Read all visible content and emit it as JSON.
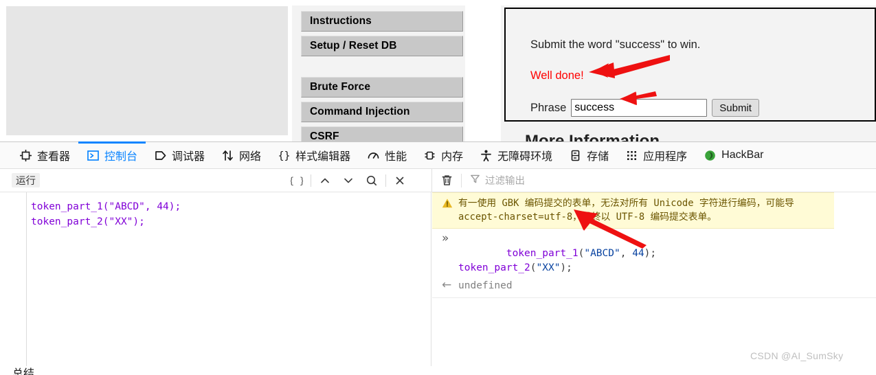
{
  "page": {
    "menu": {
      "items": [
        {
          "label": "Instructions",
          "name": "menu-instructions"
        },
        {
          "label": "Setup / Reset DB",
          "name": "menu-setup-reset-db"
        },
        {
          "label": "Brute Force",
          "name": "menu-brute-force"
        },
        {
          "label": "Command Injection",
          "name": "menu-command-injection"
        },
        {
          "label": "CSRF",
          "name": "menu-csrf"
        }
      ]
    },
    "xss": {
      "prompt": "Submit the word \"success\" to win.",
      "result": "Well done!",
      "phrase_label": "Phrase",
      "phrase_value": "success",
      "submit_label": "Submit",
      "more_info_heading": "More Information"
    }
  },
  "devtools": {
    "tabs": [
      {
        "label": "查看器",
        "icon": "inspector-icon",
        "active": false
      },
      {
        "label": "控制台",
        "icon": "console-icon",
        "active": true
      },
      {
        "label": "调试器",
        "icon": "debugger-icon",
        "active": false
      },
      {
        "label": "网络",
        "icon": "network-icon",
        "active": false
      },
      {
        "label": "样式编辑器",
        "icon": "style-editor-icon",
        "active": false
      },
      {
        "label": "性能",
        "icon": "performance-icon",
        "active": false
      },
      {
        "label": "内存",
        "icon": "memory-icon",
        "active": false
      },
      {
        "label": "无障碍环境",
        "icon": "accessibility-icon",
        "active": false
      },
      {
        "label": "存储",
        "icon": "storage-icon",
        "active": false
      },
      {
        "label": "应用程序",
        "icon": "application-icon",
        "active": false
      },
      {
        "label": "HackBar",
        "icon": "hackbar-icon",
        "active": false
      }
    ],
    "toolbar": {
      "run_label": "运行",
      "pretty_print_label": "{ }",
      "prev_label": "∧",
      "next_label": "∨",
      "find_label": "search-icon",
      "close_label": "✕",
      "trash_label": "trash-icon",
      "filter_placeholder": "过滤输出"
    },
    "editor": {
      "code_line_1": "token_part_1(\"ABCD\", 44);",
      "code_line_2": "token_part_2(\"XX\");"
    },
    "output": {
      "warning": {
        "line1": "有一使用 GBK 编码提交的表单，无法对所有 Unicode 字符进行编码，可能导",
        "line2": "accept-charset=utf-8，最终以 UTF-8 编码提交表单。"
      },
      "command": {
        "marker": "»",
        "line1_fn": "token_part_1",
        "line1_arg1": "\"ABCD\"",
        "line1_arg2": "44",
        "line2_fn": "token_part_2",
        "line2_arg1": "\"XX\""
      },
      "result": {
        "marker": "←",
        "value": "undefined"
      }
    }
  },
  "footer": {
    "summary": "总结",
    "watermark": "CSDN @AI_SumSky"
  },
  "colors": {
    "accent": "#0a84ff",
    "warning_bg": "#fffbd6",
    "error_red": "#ff0000",
    "arrow_red": "#ee1111",
    "code_purple": "#8000d7",
    "code_blue": "#0842a0"
  }
}
